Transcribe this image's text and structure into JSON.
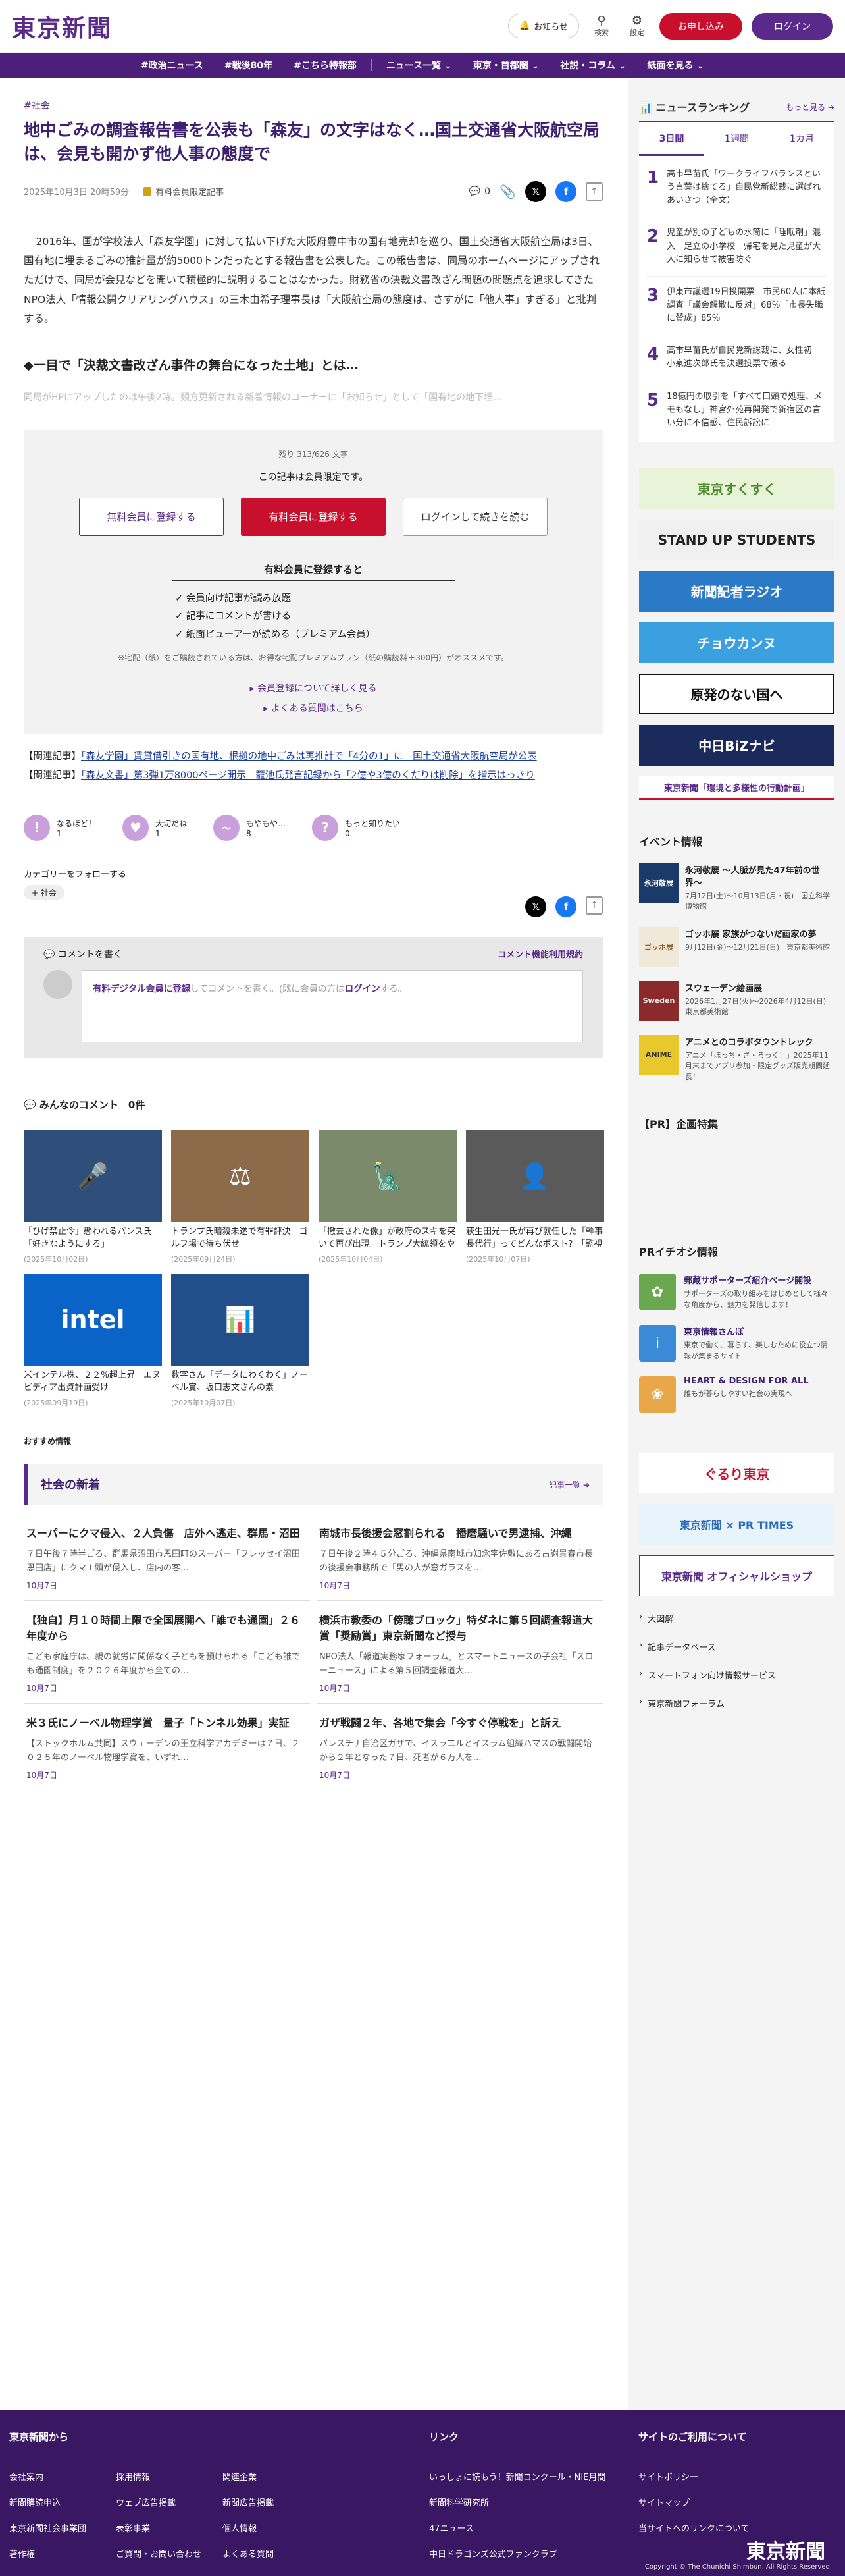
{
  "header": {
    "logo": "東京新聞",
    "notice": "お知らせ",
    "search": "検索",
    "settings": "設定",
    "apply": "お申し込み",
    "login": "ログイン"
  },
  "nav": [
    "#政治ニュース",
    "#戦後80年",
    "#こちら特報部",
    "ニュース一覧 ⌄",
    "東京・首都圏 ⌄",
    "社説・コラム ⌄",
    "紙面を見る ⌄"
  ],
  "article": {
    "tag": "#社会",
    "title": "地中ごみの調査報告書を公表も「森友」の文字はなく…国土交通省大阪航空局は、会見も開かず他人事の態度で",
    "date": "2025年10月3日 20時59分",
    "members_only": "有料会員限定記事",
    "comment_count": "0",
    "body": "2016年、国が学校法人「森友学園」に対して払い下げた大阪府豊中市の国有地売却を巡り、国土交通省大阪航空局は3日、国有地に埋まるごみの推計量が約5000トンだったとする報告書を公表した。この報告書は、同局のホームページにアップされただけで、同局が会見などを開いて積極的に説明することはなかった。財務省の決裁文書改ざん問題の問題点を追求してきたNPO法人「情報公開クリアリングハウス」の三木由希子理事長は「大阪航空局の態度は、さすがに「他人事」すぎる」と批判する。",
    "subhead": "◆一目で「決裁文書改ざん事件の舞台になった土地」とは…",
    "fade": "同局がHPにアップしたのは午後2時。頻方更新される新着情報のコーナーに「お知らせ」として「国有地の地下埋…"
  },
  "paywall": {
    "remain": "残り 313/626 文字",
    "msg": "この記事は会員限定です。",
    "free": "無料会員に登録する",
    "paid": "有料会員に登録する",
    "login": "ログインして続きを読む",
    "benefit_title": "有料会員に登録すると",
    "benefits": [
      "✓ 会員向け記事が読み放題",
      "✓ 記事にコメントが書ける",
      "✓ 紙面ビューアーが読める（プレミアム会員）"
    ],
    "note": "※宅配（紙）をご購読されている方は、お得な宅配プレミアムプラン（紙の購読料＋300円）がオススメです。",
    "link1": "▸ 会員登録について詳しく見る",
    "link2": "▸ よくある質問はこちら"
  },
  "related": [
    {
      "label": "【関連記事】",
      "text": "「森友学園」賃貸借引きの国有地、根拠の地中ごみは再推計で「4分の1」に　国土交通省大阪航空局が公表"
    },
    {
      "label": "【関連記事】",
      "text": "「森友文書」第3弾1万8000ページ開示　籠池氏発言記録から「2億や3億のくだりは削除」を指示はっきり"
    }
  ],
  "reactions": [
    {
      "label": "なるほど！",
      "count": "1",
      "color": "#c9a0dc",
      "icon": "!"
    },
    {
      "label": "大切だね",
      "count": "1",
      "color": "#c9a0dc",
      "icon": "♥"
    },
    {
      "label": "もやもや…",
      "count": "8",
      "color": "#c9a0dc",
      "icon": "~"
    },
    {
      "label": "もっと知りたい",
      "count": "0",
      "color": "#c9a0dc",
      "icon": "?"
    }
  ],
  "follow": {
    "title": "カテゴリーをフォローする",
    "tag": "+ 社会"
  },
  "comment": {
    "head": "コメントを書く",
    "rules": "コメント機能利用規約",
    "pre": "有料デジタル会員に登録",
    "mid": "してコメントを書く。(既に会員の方は",
    "login": "ログイン",
    "post": "する。"
  },
  "everyone": "みんなのコメント　0件",
  "cards": [
    {
      "title": "「ひげ禁止令」懸われるバンス氏「好きなようにする」",
      "date": "(2025年10月02日)",
      "bg": "#2f4f7a",
      "mark": "🎤"
    },
    {
      "title": "トランプ氏暗殺未遂で有罪評決　ゴルフ場で待ち伏せ",
      "date": "(2025年09月24日)",
      "bg": "#8b6b4a",
      "mark": "⚖"
    },
    {
      "title": "「撤去された像」が政府のスキを突いて再び出現　トランプ大統領をやゆする内容　アメリ…",
      "date": "(2025年10月04日)",
      "bg": "#7a8a6a",
      "mark": "🗽"
    },
    {
      "title": "萩生田光一氏が再び就任した「幹事長代行」ってどんなポスト？「監視役」の一面も…自…",
      "date": "(2025年10月07日)",
      "bg": "#5a5a5a",
      "mark": "👤"
    },
    {
      "title": "米インテル株、２２％超上昇　エヌビディア出資計画受け",
      "date": "(2025年09月19日)",
      "bg": "#0a64c8",
      "mark": "intel"
    },
    {
      "title": "数字さん「データにわくわく」ノーベル賞、坂口志文さんの素",
      "date": "(2025年10月07日)",
      "bg": "#234e8c",
      "mark": "📊"
    }
  ],
  "recommend": "おすすめ情報",
  "latest": {
    "title": "社会の新着",
    "more": "記事一覧 ➔",
    "items": [
      {
        "title": "スーパーにクマ侵入、２人負傷　店外へ逃走、群馬・沼田",
        "snip": "７日午後７時半ごろ、群馬県沼田市恩田町のスーパー「フレッセイ沼田恩田店」にクマ１頭が侵入し、店内の客…",
        "date": "10月7日"
      },
      {
        "title": "南城市長後援会窓割られる　播磨騒いで男逮捕、沖縄",
        "snip": "７日午後２時４５分ごろ、沖縄県南城市知念字佐敷にある古謝景春市長の後援会事務所で「男の人が窓ガラスを…",
        "date": "10月7日"
      },
      {
        "title": "【独自】月１０時間上限で全国展開へ「誰でも通園」２６年度から",
        "snip": "こども家庭庁は、親の就労に関係なく子どもを預けられる「こども誰でも通園制度」を２０２６年度から全ての…",
        "date": "10月7日"
      },
      {
        "title": "横浜市教委の「傍聴ブロック」特ダネに第５回調査報道大賞「奨励賞」東京新聞など授与",
        "snip": "NPO法人「報道実務家フォーラム」とスマートニュースの子会社「スローニュース」による第５回調査報道大…",
        "date": "10月7日"
      },
      {
        "title": "米３氏にノーベル物理学賞　量子「トンネル効果」実証",
        "snip": "【ストックホルム共同】スウェーデンの王立科学アカデミーは７日、２０２５年のノーベル物理学賞を、いずれ…",
        "date": "10月7日"
      },
      {
        "title": "ガザ戦闘２年、各地で集会「今すぐ停戦を」と訴え",
        "snip": "パレスチナ自治区ガザで、イスラエルとイスラム組織ハマスの戦闘開始から２年となった７日、死者が６万人を…",
        "date": "10月7日"
      }
    ]
  },
  "ranking": {
    "title": "ニュースランキング",
    "more": "もっと見る ➔",
    "tabs": [
      "3日間",
      "1週間",
      "1カ月"
    ],
    "items": [
      {
        "n": "1",
        "text": "高市早苗氏「ワークライフバランスという言葉は捨てる」自民党新総裁に選ばれあいさつ（全文）"
      },
      {
        "n": "2",
        "text": "児童が別の子どもの水筒に「睡眠剤」混入　足立の小学校　帰宅を見た児童が大人に知らせて被害防ぐ"
      },
      {
        "n": "3",
        "text": "伊東市議選19日投開票　市民60人に本紙調査「議会解散に反対」68％「市長失職に賛成」85％"
      },
      {
        "n": "4",
        "text": "高市早苗氏が自民党新総裁に、女性初　小泉進次郎氏を決選投票で破る"
      },
      {
        "n": "5",
        "text": "18億円の取引を「すべて口頭で処理、メモもなし」神宮外苑再開発で新宿区の言い分に不信感、住民訴訟に"
      }
    ]
  },
  "banners": [
    {
      "text": "東京すくすく",
      "bg": "#e8f3d8",
      "fg": "#4a8a2a"
    },
    {
      "text": "STAND UP STUDENTS",
      "bg": "#f0f0f0",
      "fg": "#222"
    },
    {
      "text": "新聞記者ラジオ",
      "bg": "#2a7ac8",
      "fg": "#fff"
    },
    {
      "text": "チョウカンヌ",
      "bg": "#3aa0e0",
      "fg": "#fff"
    },
    {
      "text": "原発のない国へ",
      "bg": "#fff",
      "fg": "#111"
    },
    {
      "text": "中日BiZナビ",
      "bg": "#1a2a5a",
      "fg": "#fff"
    },
    {
      "text": "東京新聞「環境と多様性の行動計画」",
      "bg": "#fff",
      "fg": "#5a2a8a"
    }
  ],
  "events": {
    "title": "イベント情報",
    "items": [
      {
        "title": "永河敬展 〜人脈が見た47年前の世界〜",
        "date": "7月12日(土)〜10月13日(月・祝)　国立科学博物館",
        "bg": "#1a3a6a",
        "thumb": "永河敬展"
      },
      {
        "title": "ゴッホ展 家族がつないだ画家の夢",
        "date": "9月12日(金)〜12月21日(日)　東京都美術館",
        "bg": "#f0e8d8",
        "thumb": "ゴッホ展"
      },
      {
        "title": "スウェーデン絵画展",
        "date": "2026年1月27日(火)〜2026年4月12日(日)　東京都美術館",
        "bg": "#8a2a2a",
        "thumb": "Sweden"
      },
      {
        "title": "アニメとのコラボタウントレック",
        "date": "アニメ「ぼっち・ざ・ろっく！」2025年11月末までアプリ参加・限定グッズ販売期間延長！",
        "bg": "#e8c82a",
        "thumb": "ANIME"
      }
    ]
  },
  "pr_title": "【PR】企画特集",
  "pr_info": {
    "title": "PRイチオシ情報",
    "items": [
      {
        "title": "郵蔵サポーターズ紹介ページ開設",
        "desc": "サポーターズの取り組みをはじめとして様々な角度から、魅力を発信します！",
        "bg": "#6aa84f",
        "icon": "✿"
      },
      {
        "title": "東京情報さんぽ",
        "desc": "東京で働く、暮らす、楽しむために役立つ情報が集まるサイト",
        "bg": "#3a8ad8",
        "icon": "i"
      },
      {
        "title": "HEART & DESIGN FOR ALL",
        "desc": "誰もが暮らしやすい社会の実現へ",
        "bg": "#e8a84a",
        "icon": "❀"
      }
    ]
  },
  "side_banners2": [
    {
      "text": "ぐるり東京",
      "bg": "#fff",
      "fg": "#c8102e"
    },
    {
      "text": "東京新聞 × PR TIMES",
      "bg": "#e8f4fb",
      "fg": "#2a6ab8"
    },
    {
      "text": "東京新聞 オフィシャルショップ",
      "bg": "#fff",
      "fg": "#5a2a8a"
    }
  ],
  "side_links": [
    "大図解",
    "記事データベース",
    "スマートフォン向け情報サービス",
    "東京新聞フォーラム"
  ],
  "footer": {
    "col1": {
      "title": "東京新聞から",
      "rows": [
        [
          "会社案内",
          "採用情報",
          "関連企業"
        ],
        [
          "新聞購読申込",
          "ウェブ広告掲載",
          "新聞広告掲載"
        ],
        [
          "東京新聞社会事業団",
          "表彰事業",
          "個人情報"
        ],
        [
          "著作権",
          "ご質問・お問い合わせ",
          "よくある質問"
        ]
      ]
    },
    "col2": {
      "title": "リンク",
      "items": [
        "いっしょに読もう！新聞コンクール・NIE月間",
        "新聞科学研究所",
        "47ニュース",
        "中日ドラゴンズ公式ファンクラブ"
      ]
    },
    "col3": {
      "title": "サイトのご利用について",
      "items": [
        "サイトポリシー",
        "サイトマップ",
        "当サイトへのリンクについて"
      ]
    },
    "logo": "東京新聞",
    "copyright": "Copyright © The Chunichi Shimbun, All Rights Reserved."
  }
}
